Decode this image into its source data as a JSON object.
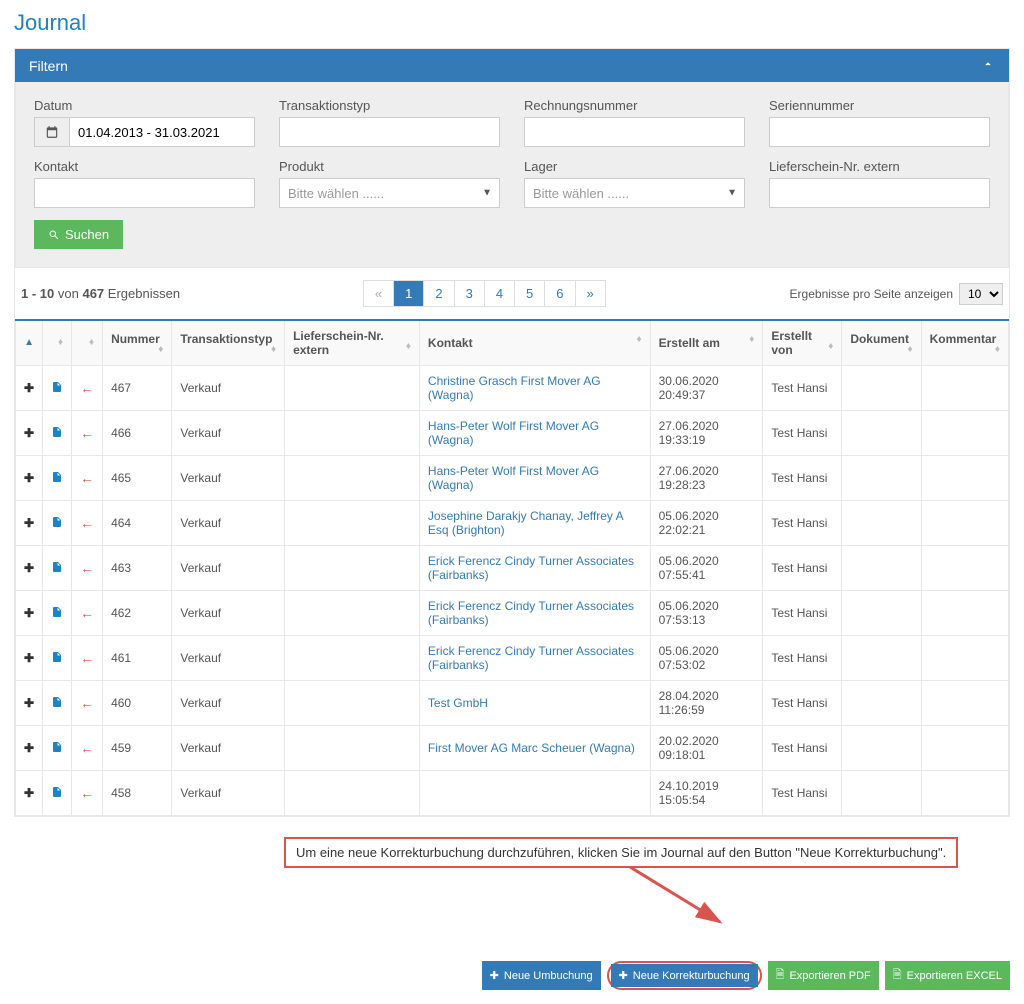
{
  "page_title": "Journal",
  "filter_panel": {
    "title": "Filtern",
    "fields": {
      "datum_label": "Datum",
      "datum_value": "01.04.2013 - 31.03.2021",
      "transaktionstyp_label": "Transaktionstyp",
      "rechnungsnummer_label": "Rechnungsnummer",
      "seriennummer_label": "Seriennummer",
      "kontakt_label": "Kontakt",
      "produkt_label": "Produkt",
      "produkt_placeholder": "Bitte wählen ......",
      "lager_label": "Lager",
      "lager_placeholder": "Bitte wählen ......",
      "lieferschein_label": "Lieferschein-Nr. extern"
    },
    "search_button": "Suchen"
  },
  "results": {
    "range": "1 - 10",
    "von": "von",
    "total": "467",
    "ergebnissen": "Ergebnissen",
    "pages": [
      "«",
      "1",
      "2",
      "3",
      "4",
      "5",
      "6",
      "»"
    ],
    "per_page_label": "Ergebnisse pro Seite anzeigen",
    "per_page_value": "10"
  },
  "table": {
    "headers": {
      "nummer": "Nummer",
      "transaktionstyp": "Transaktionstyp",
      "lieferschein": "Lieferschein-Nr. extern",
      "kontakt": "Kontakt",
      "erstellt_am": "Erstellt am",
      "erstellt_von": "Erstellt von",
      "dokument": "Dokument",
      "kommentar": "Kommentar"
    },
    "rows": [
      {
        "nummer": "467",
        "typ": "Verkauf",
        "lieferschein": "",
        "kontakt": "Christine Grasch First Mover AG (Wagna)",
        "erstellt_am": "30.06.2020 20:49:37",
        "erstellt_von": "Test Hansi"
      },
      {
        "nummer": "466",
        "typ": "Verkauf",
        "lieferschein": "",
        "kontakt": "Hans-Peter Wolf First Mover AG (Wagna)",
        "erstellt_am": "27.06.2020 19:33:19",
        "erstellt_von": "Test Hansi"
      },
      {
        "nummer": "465",
        "typ": "Verkauf",
        "lieferschein": "",
        "kontakt": "Hans-Peter Wolf First Mover AG (Wagna)",
        "erstellt_am": "27.06.2020 19:28:23",
        "erstellt_von": "Test Hansi"
      },
      {
        "nummer": "464",
        "typ": "Verkauf",
        "lieferschein": "",
        "kontakt": "Josephine Darakjy Chanay, Jeffrey A Esq (Brighton)",
        "erstellt_am": "05.06.2020 22:02:21",
        "erstellt_von": "Test Hansi"
      },
      {
        "nummer": "463",
        "typ": "Verkauf",
        "lieferschein": "",
        "kontakt": "Erick Ferencz Cindy Turner Associates (Fairbanks)",
        "erstellt_am": "05.06.2020 07:55:41",
        "erstellt_von": "Test Hansi"
      },
      {
        "nummer": "462",
        "typ": "Verkauf",
        "lieferschein": "",
        "kontakt": "Erick Ferencz Cindy Turner Associates (Fairbanks)",
        "erstellt_am": "05.06.2020 07:53:13",
        "erstellt_von": "Test Hansi"
      },
      {
        "nummer": "461",
        "typ": "Verkauf",
        "lieferschein": "",
        "kontakt": "Erick Ferencz Cindy Turner Associates (Fairbanks)",
        "erstellt_am": "05.06.2020 07:53:02",
        "erstellt_von": "Test Hansi"
      },
      {
        "nummer": "460",
        "typ": "Verkauf",
        "lieferschein": "",
        "kontakt": "Test GmbH",
        "erstellt_am": "28.04.2020 11:26:59",
        "erstellt_von": "Test Hansi"
      },
      {
        "nummer": "459",
        "typ": "Verkauf",
        "lieferschein": "",
        "kontakt": "First Mover AG Marc Scheuer (Wagna)",
        "erstellt_am": "20.02.2020 09:18:01",
        "erstellt_von": "Test Hansi"
      },
      {
        "nummer": "458",
        "typ": "Verkauf",
        "lieferschein": "",
        "kontakt": "",
        "erstellt_am": "24.10.2019 15:05:54",
        "erstellt_von": "Test Hansi"
      }
    ]
  },
  "callout": "Um eine neue Korrekturbuchung durchzuführen, klicken Sie im Journal auf den Button \"Neue Korrekturbuchung\".",
  "footer": {
    "neue_umbuchung": "Neue Umbuchung",
    "neue_korrekturbuchung": "Neue Korrekturbuchung",
    "export_pdf": "Exportieren PDF",
    "export_excel": "Exportieren EXCEL"
  }
}
